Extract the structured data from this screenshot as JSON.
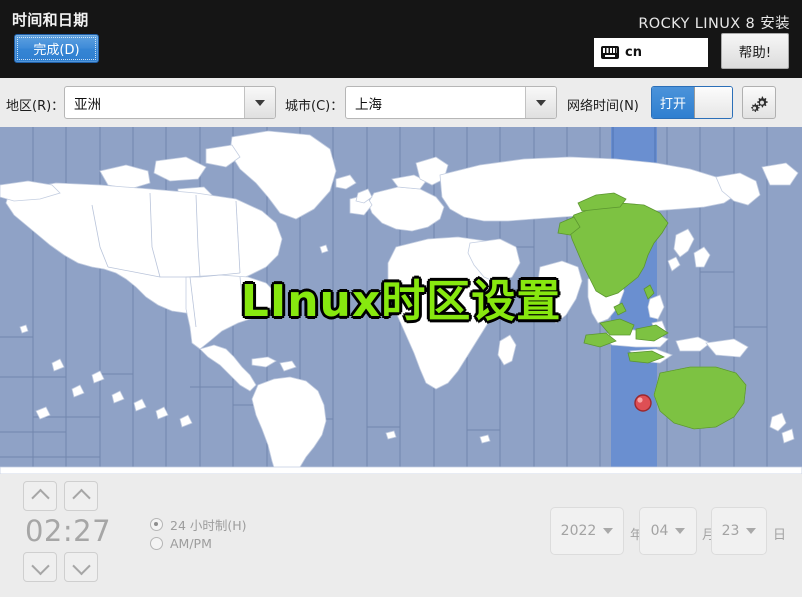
{
  "header": {
    "title": "时间和日期",
    "done_label": "完成(D)",
    "brand": "ROCKY LINUX 8 安装",
    "keyboard_layout": "cn",
    "keyboard_icon": "keyboard-icon",
    "help_label": "帮助!"
  },
  "toolbar": {
    "region_label": "地区(R)：",
    "region_value": "亚洲",
    "city_label": "城市(C)：",
    "city_value": "上海",
    "network_time_label": "网络时间(N)",
    "network_time_state": "打开",
    "settings_icon": "gear-icon"
  },
  "map": {
    "overlay_text": "LInux时区设置",
    "overlay_color": "#87e80f",
    "ocean_color": "#8fa2c6",
    "land_color": "#ffffff",
    "selected_band_color": "#6a8fd0",
    "highlight_country_color": "#7dc242",
    "marker_color": "#e03030",
    "marker_label": "location-marker"
  },
  "time": {
    "value": "02:27",
    "hour_up_icon": "chevron-up-icon",
    "minute_up_icon": "chevron-up-icon",
    "hour_down_icon": "chevron-down-icon",
    "minute_down_icon": "chevron-down-icon",
    "format_24h_label": "24 小时制(H)",
    "format_ampm_label": "AM/PM",
    "format_selected": "24h"
  },
  "date": {
    "year_value": "2022",
    "year_unit": "年",
    "month_value": "04",
    "month_unit": "月",
    "day_value": "23",
    "day_unit": "日"
  }
}
